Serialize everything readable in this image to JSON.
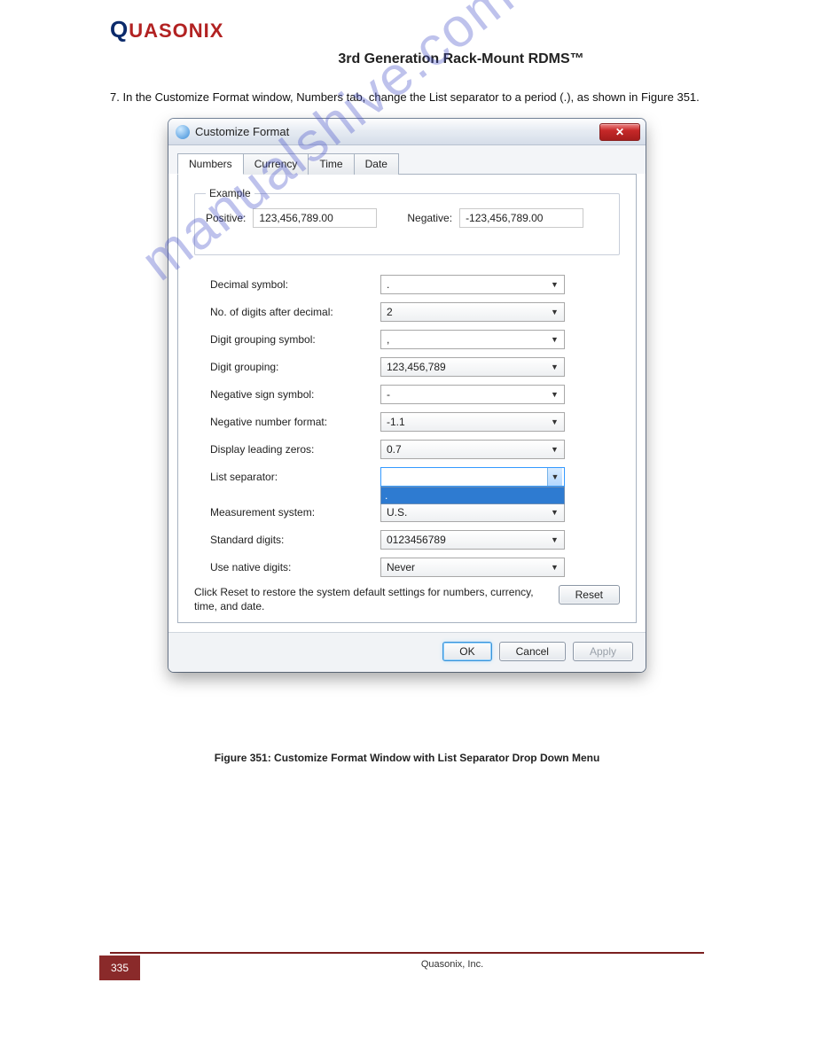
{
  "brand": {
    "q": "Q",
    "rest": "uasonix"
  },
  "subtitle": "3rd Generation Rack-Mount RDMS™",
  "intro": "7. In the Customize Format window, Numbers tab, change the List separator to a period (.), as shown in Figure 351.",
  "dialog": {
    "title": "Customize Format",
    "tabs": [
      "Numbers",
      "Currency",
      "Time",
      "Date"
    ],
    "active_tab": 0,
    "example": {
      "legend": "Example",
      "pos_label": "Positive:",
      "pos_value": "123,456,789.00",
      "neg_label": "Negative:",
      "neg_value": "-123,456,789.00"
    },
    "rows": [
      {
        "label": "Decimal symbol:",
        "value": ".",
        "editable": true
      },
      {
        "label": "No. of digits after decimal:",
        "value": "2"
      },
      {
        "label": "Digit grouping symbol:",
        "value": ",",
        "editable": true
      },
      {
        "label": "Digit grouping:",
        "value": "123,456,789"
      },
      {
        "label": "Negative sign symbol:",
        "value": "-",
        "editable": true
      },
      {
        "label": "Negative number format:",
        "value": "-1.1"
      },
      {
        "label": "Display leading zeros:",
        "value": "0.7"
      },
      {
        "label": "List separator:",
        "value": "",
        "open": true,
        "popup": "."
      },
      {
        "label": "Measurement system:",
        "value": "U.S."
      },
      {
        "label": "Standard digits:",
        "value": "0123456789"
      },
      {
        "label": "Use native digits:",
        "value": "Never"
      }
    ],
    "reset_text": "Click Reset to restore the system default settings for numbers, currency, time, and date.",
    "reset_label": "Reset",
    "ok_label": "OK",
    "cancel_label": "Cancel",
    "apply_label": "Apply"
  },
  "caption": "Figure 351: Customize Format Window with List Separator Drop Down Menu",
  "page_number": "335",
  "footer": "Quasonix, Inc.",
  "watermark": "manualshive.com"
}
